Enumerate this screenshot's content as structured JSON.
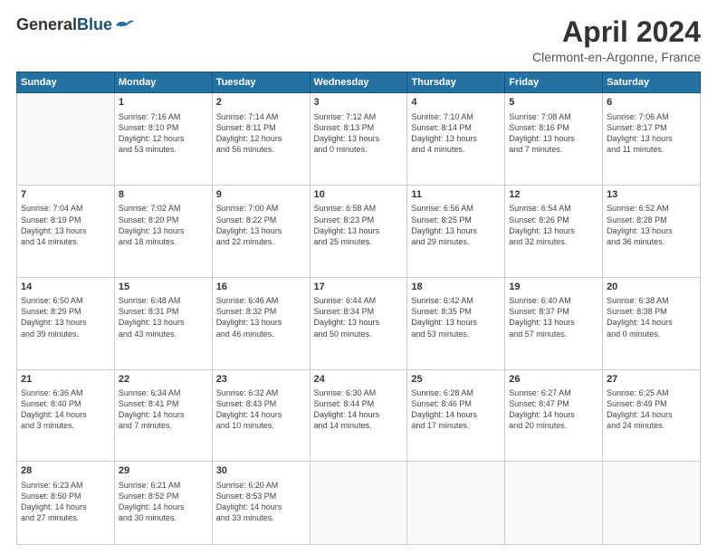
{
  "header": {
    "logo_general": "General",
    "logo_blue": "Blue",
    "month_title": "April 2024",
    "location": "Clermont-en-Argonne, France"
  },
  "days_of_week": [
    "Sunday",
    "Monday",
    "Tuesday",
    "Wednesday",
    "Thursday",
    "Friday",
    "Saturday"
  ],
  "weeks": [
    [
      {
        "day": "",
        "info": ""
      },
      {
        "day": "1",
        "info": "Sunrise: 7:16 AM\nSunset: 8:10 PM\nDaylight: 12 hours\nand 53 minutes."
      },
      {
        "day": "2",
        "info": "Sunrise: 7:14 AM\nSunset: 8:11 PM\nDaylight: 12 hours\nand 56 minutes."
      },
      {
        "day": "3",
        "info": "Sunrise: 7:12 AM\nSunset: 8:13 PM\nDaylight: 13 hours\nand 0 minutes."
      },
      {
        "day": "4",
        "info": "Sunrise: 7:10 AM\nSunset: 8:14 PM\nDaylight: 13 hours\nand 4 minutes."
      },
      {
        "day": "5",
        "info": "Sunrise: 7:08 AM\nSunset: 8:16 PM\nDaylight: 13 hours\nand 7 minutes."
      },
      {
        "day": "6",
        "info": "Sunrise: 7:06 AM\nSunset: 8:17 PM\nDaylight: 13 hours\nand 11 minutes."
      }
    ],
    [
      {
        "day": "7",
        "info": "Sunrise: 7:04 AM\nSunset: 8:19 PM\nDaylight: 13 hours\nand 14 minutes."
      },
      {
        "day": "8",
        "info": "Sunrise: 7:02 AM\nSunset: 8:20 PM\nDaylight: 13 hours\nand 18 minutes."
      },
      {
        "day": "9",
        "info": "Sunrise: 7:00 AM\nSunset: 8:22 PM\nDaylight: 13 hours\nand 22 minutes."
      },
      {
        "day": "10",
        "info": "Sunrise: 6:58 AM\nSunset: 8:23 PM\nDaylight: 13 hours\nand 25 minutes."
      },
      {
        "day": "11",
        "info": "Sunrise: 6:56 AM\nSunset: 8:25 PM\nDaylight: 13 hours\nand 29 minutes."
      },
      {
        "day": "12",
        "info": "Sunrise: 6:54 AM\nSunset: 8:26 PM\nDaylight: 13 hours\nand 32 minutes."
      },
      {
        "day": "13",
        "info": "Sunrise: 6:52 AM\nSunset: 8:28 PM\nDaylight: 13 hours\nand 36 minutes."
      }
    ],
    [
      {
        "day": "14",
        "info": "Sunrise: 6:50 AM\nSunset: 8:29 PM\nDaylight: 13 hours\nand 39 minutes."
      },
      {
        "day": "15",
        "info": "Sunrise: 6:48 AM\nSunset: 8:31 PM\nDaylight: 13 hours\nand 43 minutes."
      },
      {
        "day": "16",
        "info": "Sunrise: 6:46 AM\nSunset: 8:32 PM\nDaylight: 13 hours\nand 46 minutes."
      },
      {
        "day": "17",
        "info": "Sunrise: 6:44 AM\nSunset: 8:34 PM\nDaylight: 13 hours\nand 50 minutes."
      },
      {
        "day": "18",
        "info": "Sunrise: 6:42 AM\nSunset: 8:35 PM\nDaylight: 13 hours\nand 53 minutes."
      },
      {
        "day": "19",
        "info": "Sunrise: 6:40 AM\nSunset: 8:37 PM\nDaylight: 13 hours\nand 57 minutes."
      },
      {
        "day": "20",
        "info": "Sunrise: 6:38 AM\nSunset: 8:38 PM\nDaylight: 14 hours\nand 0 minutes."
      }
    ],
    [
      {
        "day": "21",
        "info": "Sunrise: 6:36 AM\nSunset: 8:40 PM\nDaylight: 14 hours\nand 3 minutes."
      },
      {
        "day": "22",
        "info": "Sunrise: 6:34 AM\nSunset: 8:41 PM\nDaylight: 14 hours\nand 7 minutes."
      },
      {
        "day": "23",
        "info": "Sunrise: 6:32 AM\nSunset: 8:43 PM\nDaylight: 14 hours\nand 10 minutes."
      },
      {
        "day": "24",
        "info": "Sunrise: 6:30 AM\nSunset: 8:44 PM\nDaylight: 14 hours\nand 14 minutes."
      },
      {
        "day": "25",
        "info": "Sunrise: 6:28 AM\nSunset: 8:46 PM\nDaylight: 14 hours\nand 17 minutes."
      },
      {
        "day": "26",
        "info": "Sunrise: 6:27 AM\nSunset: 8:47 PM\nDaylight: 14 hours\nand 20 minutes."
      },
      {
        "day": "27",
        "info": "Sunrise: 6:25 AM\nSunset: 8:49 PM\nDaylight: 14 hours\nand 24 minutes."
      }
    ],
    [
      {
        "day": "28",
        "info": "Sunrise: 6:23 AM\nSunset: 8:50 PM\nDaylight: 14 hours\nand 27 minutes."
      },
      {
        "day": "29",
        "info": "Sunrise: 6:21 AM\nSunset: 8:52 PM\nDaylight: 14 hours\nand 30 minutes."
      },
      {
        "day": "30",
        "info": "Sunrise: 6:20 AM\nSunset: 8:53 PM\nDaylight: 14 hours\nand 33 minutes."
      },
      {
        "day": "",
        "info": ""
      },
      {
        "day": "",
        "info": ""
      },
      {
        "day": "",
        "info": ""
      },
      {
        "day": "",
        "info": ""
      }
    ]
  ]
}
